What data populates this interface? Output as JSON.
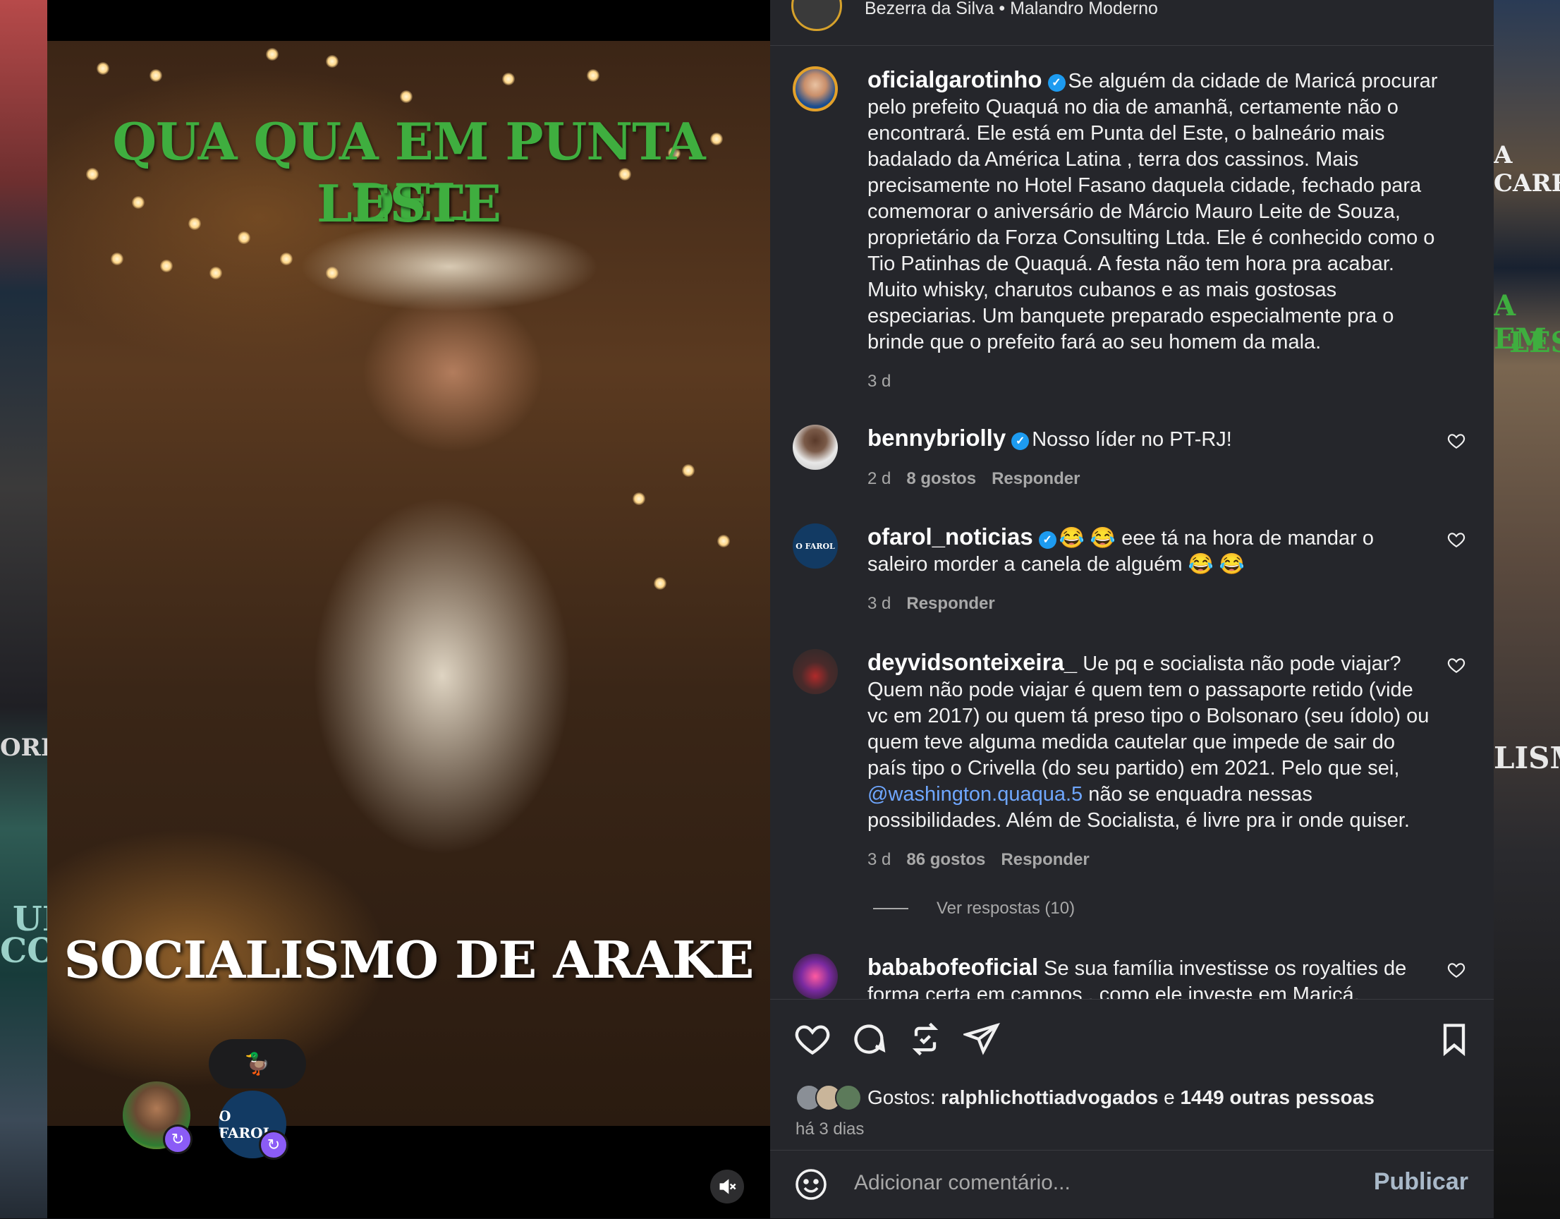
{
  "media": {
    "headline_top_line1": "QUA QUA EM PUNTA DEL",
    "headline_top_line2": "LESTE",
    "headline_bottom": "SOCIALISMO DE ARAKE",
    "sticker": "🦆",
    "reposter_logo": "O FAROL",
    "repost_icon": "↻"
  },
  "background_right": {
    "text1": "A CARR",
    "text2": "A EM",
    "text3": "LES",
    "text4": "LISM"
  },
  "background_left": {
    "text1": "ORI",
    "text2": "UN",
    "text3": "COM"
  },
  "header": {
    "text": "Bezerra da Silva • Malandro Moderno"
  },
  "post": {
    "username": "oficialgarotinho",
    "caption": "Se alguém da cidade de Maricá procurar pelo prefeito Quaquá no dia de amanhã, certamente não o encontrará. Ele está em Punta del Este, o balneário mais badalado da América Latina , terra dos cassinos. Mais precisamente no Hotel Fasano daquela cidade, fechado para comemorar o aniversário de Márcio Mauro Leite de Souza, proprietário da Forza Consulting Ltda. Ele é conhecido como o Tio Patinhas de Quaquá. A festa não tem hora pra acabar. Muito whisky, charutos cubanos e as mais gostosas especiarias. Um banquete preparado especialmente pra o brinde que o prefeito fará ao seu homem da mala.",
    "time": "3 d"
  },
  "comments": [
    {
      "username": "bennybriolly",
      "text": "Nosso líder no PT-RJ!",
      "time": "2 d",
      "likes": "8 gostos",
      "reply": "Responder"
    },
    {
      "username": "ofarol_noticias",
      "text": "😂 😂 eee tá na hora de mandar o saleiro morder a canela de alguém 😂 😂",
      "time": "3 d",
      "reply": "Responder",
      "avatar_label": "O FAROL"
    },
    {
      "username": "deyvidsonteixeira_",
      "text_before": "Ue pq e socialista não pode viajar? Quem não pode viajar é quem tem o passaporte retido (vide vc em 2017) ou quem tá preso tipo o Bolsonaro (seu ídolo) ou quem teve alguma medida cautelar que impede de sair do país tipo o Crivella (do seu partido) em 2021. Pelo que sei, ",
      "mention": "@washington.quaqua.5",
      "text_after": " não se enquadra nessas possibilidades. Além de Socialista, é livre pra ir onde quiser.",
      "time": "3 d",
      "likes": "86 gostos",
      "reply": "Responder",
      "view_replies": "Ver respostas (10)"
    },
    {
      "username": "bababofeoficial",
      "text": "Se sua família investisse os royalties de forma certa em campos , como ele investe em Maricá, Campos"
    }
  ],
  "actions": {
    "likes_prefix": "Gostos:",
    "likes_user": "ralphlichottiadvogados",
    "likes_joiner": "e",
    "likes_others": "1449 outras pessoas",
    "date": "há 3 dias"
  },
  "composer": {
    "placeholder": "Adicionar comentário...",
    "publish": "Publicar"
  }
}
